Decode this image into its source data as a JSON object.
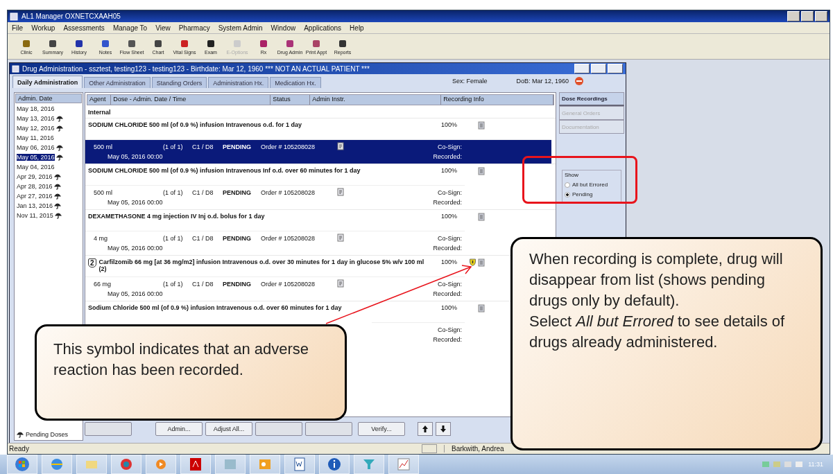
{
  "window": {
    "title": "AL1 Manager OXNETCXAAH05"
  },
  "menu": [
    "File",
    "Workup",
    "Assessments",
    "Manage To",
    "View",
    "Pharmacy",
    "System Admin",
    "Window",
    "Applications",
    "Help"
  ],
  "toolbar": [
    {
      "label": "Clinic",
      "disabled": false
    },
    {
      "label": "Summary",
      "disabled": false
    },
    {
      "label": "History",
      "disabled": false
    },
    {
      "label": "Notes",
      "disabled": false
    },
    {
      "label": "Flow Sheet",
      "disabled": false
    },
    {
      "label": "Chart",
      "disabled": false
    },
    {
      "label": "Vital Signs",
      "disabled": false
    },
    {
      "label": "Exam",
      "disabled": false
    },
    {
      "label": "E-Options",
      "disabled": true
    },
    {
      "label": "Rx",
      "disabled": false
    },
    {
      "label": "Drug Admin",
      "disabled": false
    },
    {
      "label": "Print Appt",
      "disabled": false
    },
    {
      "label": "Reports",
      "disabled": false
    }
  ],
  "drug_window": {
    "title": "Drug Administration - ssztest, testing123 - testing123 - Birthdate: Mar 12, 1960 *** NOT AN ACTUAL PATIENT ***",
    "tabs": [
      {
        "label": "Daily Administration",
        "selected": true
      },
      {
        "label": "Other Administration",
        "selected": false
      },
      {
        "label": "Standing Orders",
        "selected": false
      },
      {
        "label": "Administration Hx.",
        "selected": false
      },
      {
        "label": "Medication Hx.",
        "selected": false
      }
    ],
    "sex": "Sex: Female",
    "dob": "DoB: Mar 12, 1960",
    "dates": {
      "header": "Admin. Date",
      "items": [
        {
          "label": "May 18, 2016",
          "pending": false,
          "selected": false
        },
        {
          "label": "May 13, 2016",
          "pending": true,
          "selected": false
        },
        {
          "label": "May 12, 2016",
          "pending": true,
          "selected": false
        },
        {
          "label": "May 11, 2016",
          "pending": false,
          "selected": false
        },
        {
          "label": "May 06, 2016",
          "pending": true,
          "selected": false
        },
        {
          "label": "May 05, 2016",
          "pending": true,
          "selected": true
        },
        {
          "label": "May 04, 2016",
          "pending": false,
          "selected": false
        },
        {
          "label": "Apr 29, 2016",
          "pending": true,
          "selected": false
        },
        {
          "label": "Apr 28, 2016",
          "pending": true,
          "selected": false
        },
        {
          "label": "Apr 27, 2016",
          "pending": true,
          "selected": false
        },
        {
          "label": "Jan 13, 2016",
          "pending": true,
          "selected": false
        },
        {
          "label": "Nov 11, 2015",
          "pending": true,
          "selected": false
        }
      ],
      "legend": "Pending Doses"
    },
    "table": {
      "columns": [
        "Agent",
        "Dose - Admin. Date / Time",
        "Status",
        "Admin Instr.",
        "Recording Info"
      ],
      "section": "Internal",
      "orders": [
        {
          "description": "SODIUM CHLORIDE 500 ml (of 0.9 %) infusion Intravenous o.d. for 1 day",
          "percent": "100%",
          "adverse_reaction": false,
          "dose": {
            "amount": "500 ml",
            "count": "(1 of 1)",
            "code": "C1 / D8",
            "status": "PENDING",
            "order": "Order # 105208028",
            "date": "May 05, 2016 00:00",
            "cosign": "Co-Sign:",
            "recorded": "Recorded:",
            "selected": true
          }
        },
        {
          "description": "SODIUM CHLORIDE 500 ml (of 0.9 %) infusion Intravenous Inf o.d. over 60 minutes for 1 day",
          "percent": "100%",
          "adverse_reaction": false,
          "dose": {
            "amount": "500 ml",
            "count": "(1 of 1)",
            "code": "C1 / D8",
            "status": "PENDING",
            "order": "Order # 105208028",
            "date": "May 05, 2016 00:00",
            "cosign": "Co-Sign:",
            "recorded": "Recorded:",
            "selected": false
          }
        },
        {
          "description": "DEXAMETHASONE 4 mg injection IV Inj o.d. bolus for 1 day",
          "percent": "100%",
          "adverse_reaction": false,
          "dose": {
            "amount": "4 mg",
            "count": "(1 of 1)",
            "code": "C1 / D8",
            "status": "PENDING",
            "order": "Order # 105208028",
            "date": "May 05, 2016 00:00",
            "cosign": "Co-Sign:",
            "recorded": "Recorded:",
            "selected": false
          }
        },
        {
          "bag_number": "2",
          "description": "Carfilzomib 66 mg [at 36 mg/m2] infusion Intravenous o.d. over 30 minutes for 1 day in glucose 5% w/v 100 ml (2)",
          "percent": "100%",
          "adverse_reaction": true,
          "dose": {
            "amount": "66 mg",
            "count": "(1 of 1)",
            "code": "C1 / D8",
            "status": "PENDING",
            "order": "Order # 105208028",
            "date": "May 05, 2016 00:00",
            "cosign": "Co-Sign:",
            "recorded": "Recorded:",
            "selected": false
          }
        },
        {
          "description": "Sodium Chloride 500 ml (of 0.9 %) infusion Intravenous o.d. over 60 minutes for 1 day",
          "percent": "100%",
          "adverse_reaction": false,
          "dose": {
            "cosign": "Co-Sign:",
            "recorded": "Recorded:",
            "selected": false
          }
        }
      ]
    },
    "side_tabs": [
      {
        "label": "Dose Recordings",
        "selected": true,
        "disabled": false
      },
      {
        "label": "General Orders",
        "selected": false,
        "disabled": true
      },
      {
        "label": "Documentation",
        "selected": false,
        "disabled": true
      }
    ],
    "show": {
      "legend": "Show",
      "options": [
        {
          "label": "All but Errored",
          "selected": false
        },
        {
          "label": "Pending",
          "selected": true
        }
      ]
    },
    "buttons": [
      {
        "disabled": true
      },
      {
        "label": "Admin...",
        "disabled": false
      },
      {
        "label": "Adjust All...",
        "disabled": false
      },
      {
        "disabled": true
      },
      {
        "disabled": true
      },
      {
        "label": "Verify...",
        "disabled": false
      }
    ]
  },
  "status_bar": {
    "message": "Ready",
    "user": "Barkwith, Andrea"
  },
  "taskbar": {
    "clock": "11:31"
  },
  "callouts": [
    {
      "paragraphs": [
        "This symbol indicates that an adverse reaction has been recorded."
      ]
    },
    {
      "paragraphs": [
        "When recording is complete, drug will disappear from list (shows pending drugs only by default).",
        "Select *All but Errored* to see details of drugs already administered."
      ]
    }
  ]
}
